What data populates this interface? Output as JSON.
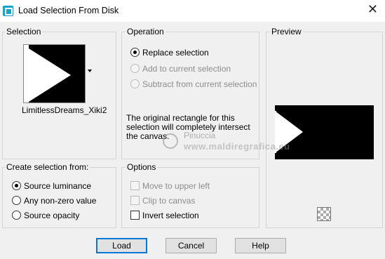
{
  "window": {
    "title": "Load Selection From Disk",
    "close": "✕"
  },
  "selection": {
    "label": "Selection",
    "name": "LimitlessDreams_Xiki2"
  },
  "operation": {
    "label": "Operation",
    "options": [
      "Replace selection",
      "Add to current selection",
      "Subtract from current selection"
    ],
    "selected": "Replace selection",
    "info": "The original rectangle for this selection will completely intersect the canvas."
  },
  "preview": {
    "label": "Preview"
  },
  "create_from": {
    "label": "Create selection from:",
    "options": [
      "Source luminance",
      "Any non-zero value",
      "Source opacity"
    ],
    "selected": "Source luminance"
  },
  "options": {
    "label": "Options",
    "items": [
      {
        "label": "Move to upper left",
        "checked": false,
        "enabled": false
      },
      {
        "label": "Clip to canvas",
        "checked": false,
        "enabled": false
      },
      {
        "label": "Invert selection",
        "checked": false,
        "enabled": true
      }
    ]
  },
  "watermark": {
    "name": "Pinuccia",
    "url": "www.maldiregrafica.eu"
  },
  "buttons": {
    "load": "Load",
    "cancel": "Cancel",
    "help": "Help"
  }
}
